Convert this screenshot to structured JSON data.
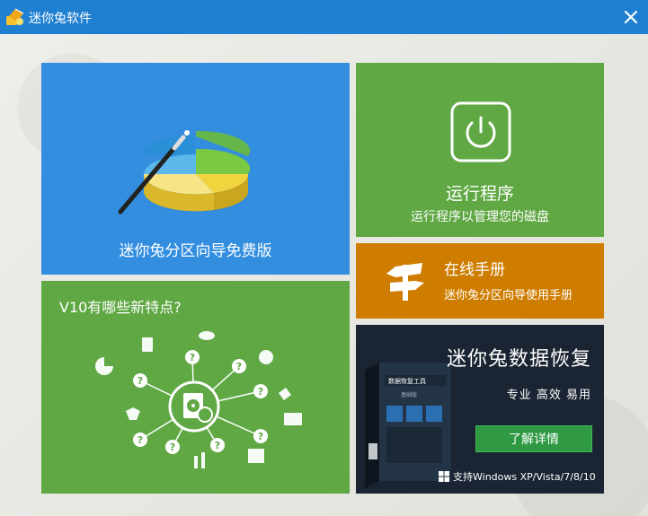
{
  "window": {
    "title": "迷你兔软件",
    "accent": "#1f7fd1"
  },
  "tiles": {
    "partition": {
      "label": "迷你兔分区向导免费版",
      "color": "#338ee0",
      "icon": "pie-chart-wand-icon"
    },
    "run": {
      "title": "运行程序",
      "subtitle": "运行程序以管理您的磁盘",
      "color": "#5fa844",
      "icon": "power-icon"
    },
    "manual": {
      "title": "在线手册",
      "subtitle": "迷你兔分区向导使用手册",
      "color": "#cf7d00",
      "icon": "signpost-icon"
    },
    "features": {
      "title": "V10有哪些新特点?",
      "color": "#5fa844",
      "question_mark": "?"
    },
    "recovery": {
      "title": "迷你兔数据恢复",
      "slogan": "专业 高效 易用",
      "button_label": "了解详情",
      "support_text": "支持Windows XP/Vista/7/8/10",
      "box_title": "数据恢复工具",
      "box_edition": "基础版",
      "color": "#1a2432",
      "button_color": "#2f9a43"
    }
  }
}
